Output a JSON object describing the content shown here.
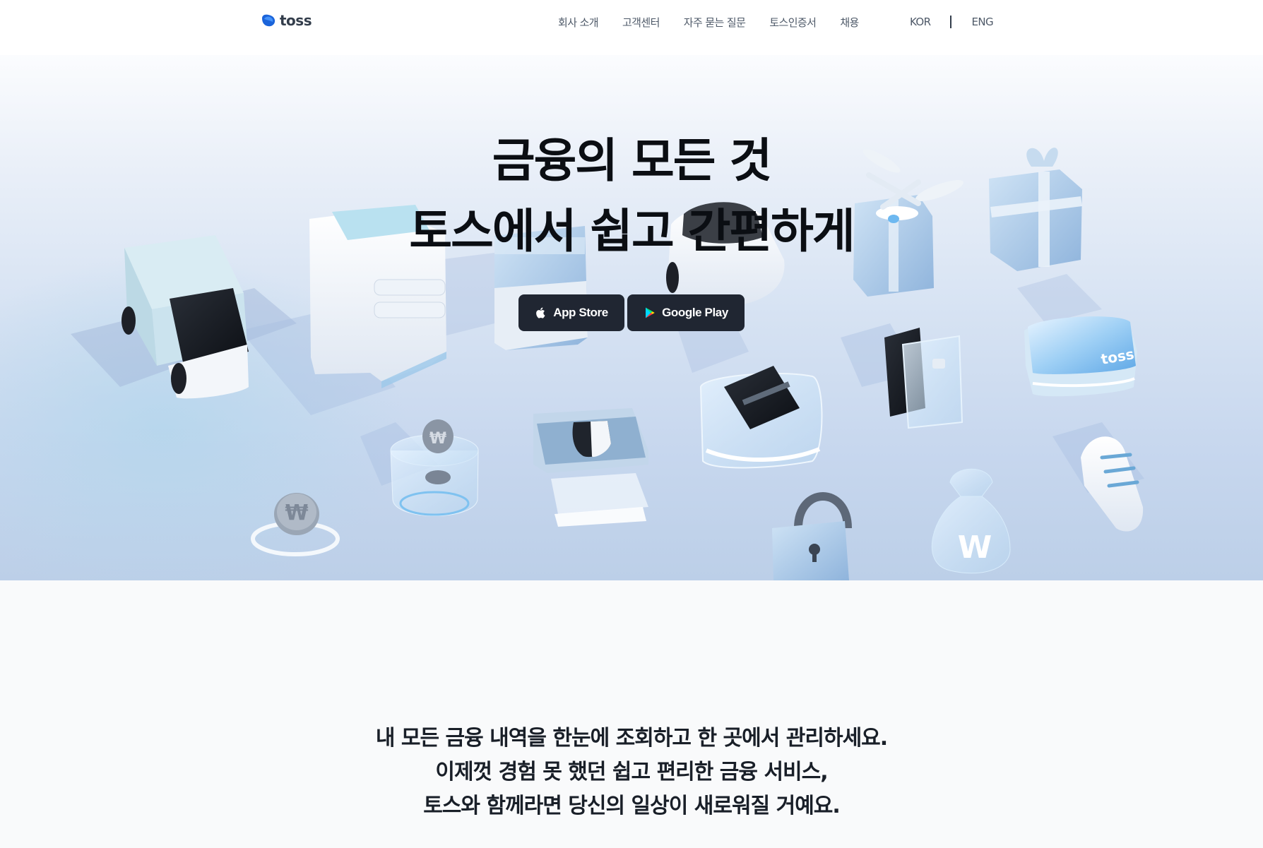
{
  "header": {
    "logo_text": "toss",
    "nav": [
      {
        "label": "회사 소개"
      },
      {
        "label": "고객센터"
      },
      {
        "label": "자주 묻는 질문"
      },
      {
        "label": "토스인증서"
      },
      {
        "label": "채용"
      }
    ],
    "lang": {
      "kor": "KOR",
      "eng": "ENG"
    }
  },
  "hero": {
    "title_line1": "금융의 모든 것",
    "title_line2": "토스에서 쉽고 간편하게",
    "app_store_label": "App Store",
    "google_play_label": "Google Play",
    "toss_card_text": "toss"
  },
  "intro": {
    "line1": "내 모든 금융 내역을 한눈에 조회하고 한 곳에서 관리하세요.",
    "line2": "이제껏 경험 못 했던 쉽고 편리한 금융 서비스,",
    "line3": "토스와 함께라면 당신의 일상이 새로워질 거예요."
  },
  "colors": {
    "brand_blue": "#3182f6",
    "button_dark": "#202632",
    "text_primary": "#191f28"
  }
}
